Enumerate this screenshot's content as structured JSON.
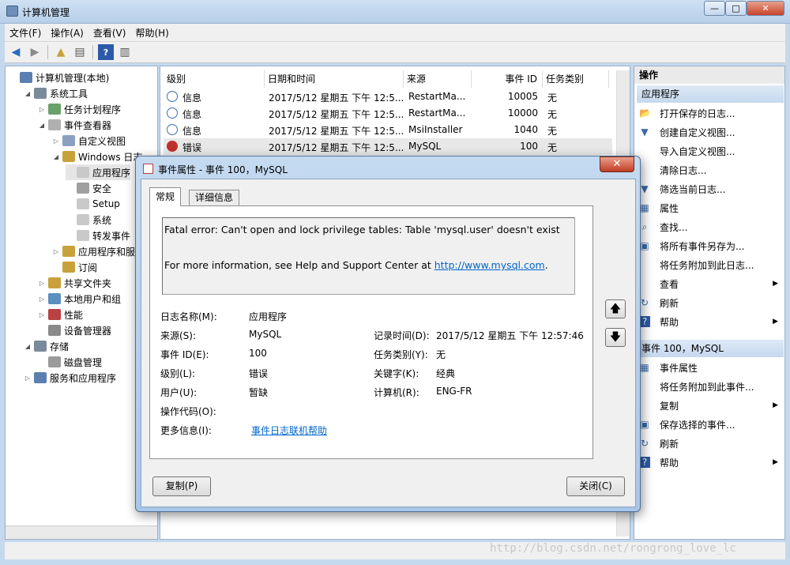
{
  "window": {
    "title": "计算机管理",
    "min": "—",
    "max": "□",
    "close": "✕"
  },
  "menu": [
    "文件(F)",
    "操作(A)",
    "查看(V)",
    "帮助(H)"
  ],
  "tree": {
    "items": [
      {
        "label": "计算机管理(本地)",
        "level": 0,
        "exp": ""
      },
      {
        "label": "系统工具",
        "level": 1,
        "exp": "◢"
      },
      {
        "label": "任务计划程序",
        "level": 2,
        "exp": "▷"
      },
      {
        "label": "事件查看器",
        "level": 2,
        "exp": "◢"
      },
      {
        "label": "自定义视图",
        "level": 3,
        "exp": "▷"
      },
      {
        "label": "Windows 日志",
        "level": 3,
        "exp": "◢"
      },
      {
        "label": "应用程序",
        "level": 4,
        "exp": ""
      },
      {
        "label": "安全",
        "level": 4,
        "exp": ""
      },
      {
        "label": "Setup",
        "level": 4,
        "exp": ""
      },
      {
        "label": "系统",
        "level": 4,
        "exp": ""
      },
      {
        "label": "转发事件",
        "level": 4,
        "exp": ""
      },
      {
        "label": "应用程序和服务",
        "level": 3,
        "exp": "▷"
      },
      {
        "label": "订阅",
        "level": 3,
        "exp": ""
      },
      {
        "label": "共享文件夹",
        "level": 2,
        "exp": "▷"
      },
      {
        "label": "本地用户和组",
        "level": 2,
        "exp": "▷"
      },
      {
        "label": "性能",
        "level": 2,
        "exp": "▷"
      },
      {
        "label": "设备管理器",
        "level": 2,
        "exp": ""
      },
      {
        "label": "存储",
        "level": 1,
        "exp": "◢"
      },
      {
        "label": "磁盘管理",
        "level": 2,
        "exp": ""
      },
      {
        "label": "服务和应用程序",
        "level": 1,
        "exp": "▷"
      }
    ]
  },
  "events": {
    "columns": [
      "级别",
      "日期和时间",
      "来源",
      "事件 ID",
      "任务类别"
    ],
    "rows": [
      {
        "level": "信息",
        "datetime": "2017/5/12 星期五 下午 12:5...",
        "source": "RestartMa...",
        "id": "10005",
        "category": "无"
      },
      {
        "level": "信息",
        "datetime": "2017/5/12 星期五 下午 12:5...",
        "source": "RestartMa...",
        "id": "10000",
        "category": "无"
      },
      {
        "level": "信息",
        "datetime": "2017/5/12 星期五 下午 12:5...",
        "source": "MsiInstaller",
        "id": "1040",
        "category": "无"
      },
      {
        "level": "错误",
        "datetime": "2017/5/12 星期五 下午 12:5...",
        "source": "MySQL",
        "id": "100",
        "category": "无"
      }
    ]
  },
  "actions": {
    "header": "操作",
    "section1": "应用程序",
    "items1": [
      "打开保存的日志...",
      "创建自定义视图...",
      "导入自定义视图...",
      "清除日志...",
      "筛选当前日志...",
      "属性",
      "查找...",
      "将所有事件另存为...",
      "将任务附加到此日志...",
      "查看",
      "刷新",
      "帮助"
    ],
    "section2": "事件 100，MySQL",
    "items2": [
      "事件属性",
      "将任务附加到此事件...",
      "复制",
      "保存选择的事件...",
      "刷新",
      "帮助"
    ]
  },
  "dialog": {
    "title": "事件属性 - 事件 100，MySQL",
    "close": "✕",
    "tabs": [
      "常规",
      "详细信息"
    ],
    "message_line1": "Fatal error: Can't open and lock privilege tables: Table 'mysql.user' doesn't exist",
    "message_line2_prefix": "For more information, see Help and Support Center at ",
    "message_link": "http://www.mysql.com",
    "message_line2_suffix": ".",
    "fields": {
      "log_name_label": "日志名称(M):",
      "log_name": "应用程序",
      "source_label": "来源(S):",
      "source": "MySQL",
      "logged_label": "记录时间(D):",
      "logged": "2017/5/12 星期五 下午 12:57:46",
      "event_id_label": "事件 ID(E):",
      "event_id": "100",
      "task_label": "任务类别(Y):",
      "task": "无",
      "level_label": "级别(L):",
      "level": "错误",
      "keywords_label": "关键字(K):",
      "keywords": "经典",
      "user_label": "用户(U):",
      "user": "暂缺",
      "computer_label": "计算机(R):",
      "computer": "ENG-FR",
      "opcode_label": "操作代码(O):",
      "more_info_label": "更多信息(I):",
      "more_info_link": "事件日志联机帮助"
    },
    "copy_button": "复制(P)",
    "close_button": "关闭(C)"
  },
  "watermark": "http://blog.csdn.net/rongrong_love_lc"
}
